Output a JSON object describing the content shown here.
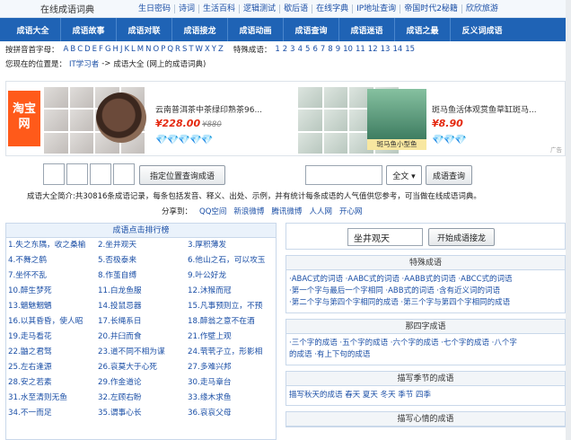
{
  "header": {
    "site_title": "在线成语词典",
    "links": [
      "生日密码",
      "诗词",
      "生活百科",
      "逻辑测试",
      "歇后语",
      "在线字典",
      "IP地址查询",
      "帝国时代2秘籍",
      "欣欣旅游"
    ]
  },
  "nav": [
    "成语大全",
    "成语故事",
    "成语对联",
    "成语接龙",
    "成语动画",
    "成语查询",
    "成语迷语",
    "成语之最",
    "反义词成语"
  ],
  "pinyin": {
    "label": "按拼音首字母：",
    "letters": [
      "A",
      "B",
      "C",
      "D",
      "E",
      "F",
      "G",
      "H",
      "J",
      "K",
      "L",
      "M",
      "N",
      "O",
      "P",
      "Q",
      "R",
      "S",
      "T",
      "W",
      "X",
      "Y",
      "Z"
    ],
    "special_label": "特殊成语：",
    "special_nums": [
      "1",
      "2",
      "3",
      "4",
      "5",
      "6",
      "7",
      "8",
      "9",
      "10",
      "11",
      "12",
      "13",
      "14",
      "15"
    ]
  },
  "location": {
    "label": "您现在的位置是：",
    "crumb1": "IT学习者",
    "sep": "->",
    "crumb2": "成语大全 (网上的成语词典)"
  },
  "ad": {
    "taobao_text": "淘宝网",
    "product1_title": "云南普洱茶中茶绿印熟茶96...",
    "product1_price": "¥228.00",
    "product1_old": "¥880",
    "product1_rating": "💎💎💎💎💎",
    "product2_title": "斑马鱼活体观赏鱼草缸斑马...",
    "product2_price": "¥8.90",
    "product2_rating": "💎💎💎",
    "product2_caption": "斑马鱼小型鱼",
    "tag": "广告"
  },
  "search": {
    "locate_button": "指定位置查询成语",
    "scope_value": "全文 ▾",
    "query_button": "成语查询"
  },
  "intro": {
    "text": "成语大全简介:共30816条成语记录，每条包括发音、释义、出处、示例，并有统计每条成语的人气值供您参考，可当做在线成语词典。",
    "share_label": "分享到：",
    "share_links": [
      "QQ空间",
      "新浪微博",
      "腾讯微博",
      "人人网",
      "开心网"
    ]
  },
  "ranking": {
    "title": "成语点击排行榜",
    "items": [
      "1.失之东隅，收之桑榆",
      "2.坐井观天",
      "3.厚积薄发",
      "4.不舞之鹤",
      "5.否极泰来",
      "6.他山之石，可以攻玉",
      "7.坐怀不乱",
      "8.作茧自缚",
      "9.叶公好龙",
      "10.醉生梦死",
      "11.白龙鱼服",
      "12.沐猴而冠",
      "13.魑魅魍魉",
      "14.投鼠忌器",
      "15.凡事预则立，不预",
      "16.以其昏昏，使人昭",
      "17.长绳系日",
      "18.醉翁之意不在酒",
      "19.走马看花",
      "20.井臼而食",
      "21.作壁上观",
      "22.鼬之君驽",
      "23.道不同不相为谋",
      "24.茕茕孑立，形影相",
      "25.左右逢源",
      "26.哀莫大于心死",
      "27.多难兴邦",
      "28.安之若素",
      "29.作金道论",
      "30.走马章台",
      "31.水至清则无鱼",
      "32.左顾右盼",
      "33.缘木求鱼",
      "34.不一而足",
      "35.谓事心长",
      "36.哀哀父母"
    ]
  },
  "jielong": {
    "input_value": "坐井观天",
    "button": "开始成语接龙"
  },
  "sections": [
    {
      "title": "特殊成语",
      "lines": [
        "·ABAC式的词语 ·AABC式的词语 ·AABB式的词语 ·ABCC式的词语",
        "·第一个字与最后一个字相同 ·ABB式的词语 ·含有近义词的词语",
        "·第二个字与第四个字相同的成语 ·第三个字与第四个字相同的成语"
      ]
    },
    {
      "title": "那四字成语",
      "lines": [
        "·三个字的成语 ·五个字的成语 ·六个字的成语 ·七个字的成语 ·八个字",
        "的成语 ·有上下句的成语"
      ]
    },
    {
      "title": "描写季节的成语",
      "lines": [
        "描写秋天的成语 春天 夏天 冬天 季节 四季"
      ]
    },
    {
      "title": "描写心情的成语",
      "lines": []
    }
  ]
}
